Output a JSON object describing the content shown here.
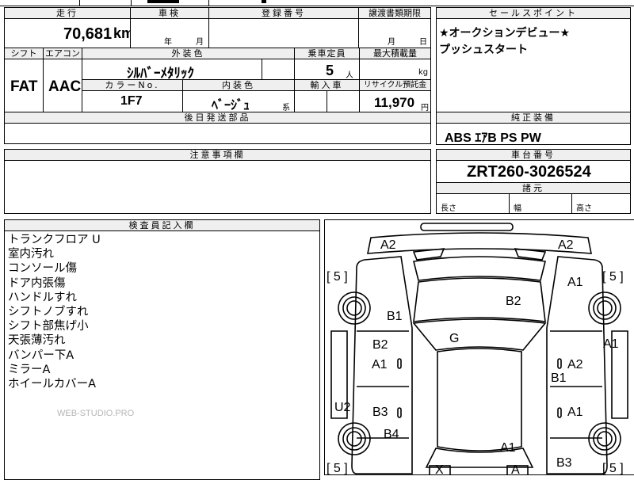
{
  "top_strip": "",
  "labels": {
    "mileage": "走行",
    "inspection": "車検",
    "registration": "登録番号",
    "transfer_deadline": "譲渡書類期限",
    "shift": "シフト",
    "aircon": "エアコン",
    "exterior_color": "外装色",
    "capacity": "乗車定員",
    "max_load": "最大積載量",
    "color_no": "カラーNo.",
    "interior_color": "内装色",
    "import_car": "輸入車",
    "recycle_fee": "リサイクル預託金",
    "later_parts": "後日発送部品",
    "sales_points": "セールスポイント",
    "genuine_equipment": "純正装備",
    "caution": "注意事項欄",
    "chassis_number": "車台番号",
    "dimensions": "諸元",
    "inspector_notes": "検査員記入欄"
  },
  "vehicle": {
    "mileage": "70,681",
    "mileage_unit": "km",
    "inspection_year_unit": "年",
    "inspection_month_unit": "月",
    "transfer_month_unit": "月",
    "transfer_day_unit": "日",
    "shift": "FAT",
    "aircon": "AAC",
    "exterior_color": "ｼﾙﾊﾞｰﾒﾀﾘｯｸ",
    "capacity": "5",
    "capacity_unit": "人",
    "max_load_unit": "kg",
    "color_no": "1F7",
    "interior_color": "ﾍﾞｰｼﾞｭ",
    "interior_suffix": "系",
    "recycle_fee": "11,970",
    "recycle_unit": "円",
    "chassis_number": "ZRT260-3026524"
  },
  "sales_points": [
    "★オークションデビュー★",
    "プッシュスタート"
  ],
  "equipment": "ABS ｴｱB PS PW",
  "dimensions": {
    "length": "長さ",
    "width": "幅",
    "height": "高さ"
  },
  "inspector_notes": [
    "トランクフロア U",
    "室内汚れ",
    "コンソール傷",
    "ドア内張傷",
    "ハンドルすれ",
    "シフトノブすれ",
    "シフト部焦げ小",
    "天張薄汚れ",
    "バンパー下A",
    "ミラーA",
    "ホイールカバーA"
  ],
  "watermark": "WEB-STUDIO.PRO",
  "diagram_marks": {
    "a2_left": "A2",
    "a2_right": "A2",
    "a1_upper_right": "A1",
    "b2_hood": "B2",
    "b1_left": "B1",
    "a1_right_edge": "A1",
    "g_windshield": "G",
    "b2_left_door": "B2",
    "a1_left_door": "A1",
    "a2_right_door": "A2",
    "b1_right": "B1",
    "b3_left_door": "B3",
    "a1_right_rear_door": "A1",
    "u2": "U2",
    "b4": "B4",
    "a1_bottom": "A1",
    "b3_bottom": "B3",
    "x_mark": "X",
    "a_mark": "A",
    "tire_left_top": "[ 5 ]",
    "tire_right_top": "[ 5 ]",
    "tire_left_bottom": "[ 5 ]",
    "tire_right_bottom": "[ 5 ]"
  }
}
